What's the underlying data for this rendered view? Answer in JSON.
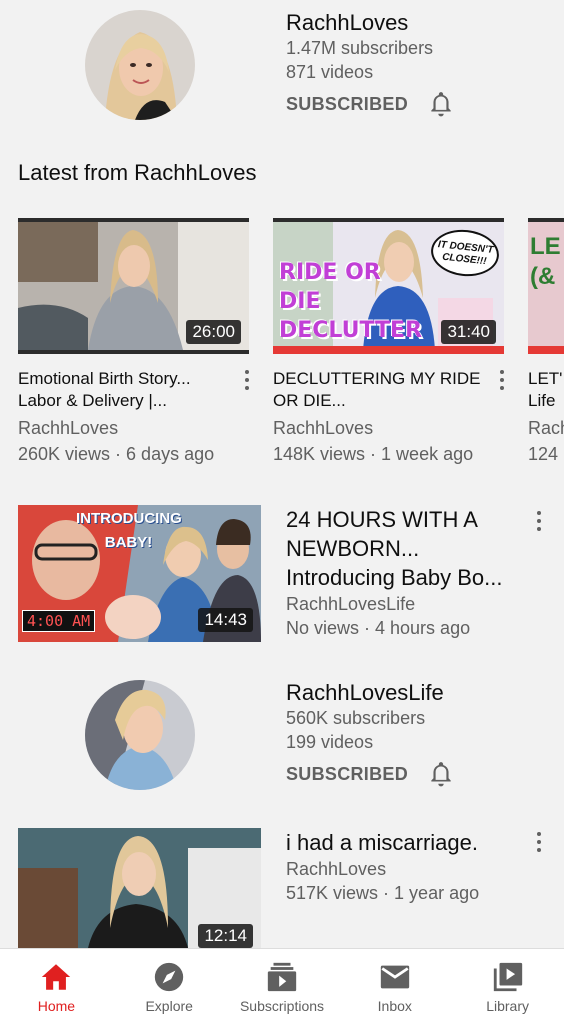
{
  "channel_1": {
    "name": "RachhLoves",
    "subscribers": "1.47M subscribers",
    "videos": "871 videos",
    "status": "SUBSCRIBED"
  },
  "section": {
    "title": "Latest from RachhLoves"
  },
  "shelf": [
    {
      "title": "Emotional Birth Story... Labor & Delivery |...",
      "channel": "RachhLoves",
      "meta": "260K views · 6 days ago",
      "duration": "26:00"
    },
    {
      "title": "DECLUTTERING MY RIDE OR DIE...",
      "channel": "RachhLoves",
      "meta": "148K views · 1 week ago",
      "duration": "31:40",
      "overlay_text": "RIDE OR DIE DECLUTTER",
      "bubble_text": "IT DOESN'T CLOSE!!!"
    },
    {
      "title": "LET' Life",
      "channel": "Rach",
      "meta": "124",
      "overlay_text": "LE (&"
    }
  ],
  "video_1": {
    "title": "24 HOURS WITH A NEWBORN... Introducing Baby Bo...",
    "channel": "RachhLovesLife",
    "meta": "No views · 4 hours ago",
    "duration": "14:43",
    "overlay_text": "INTRODUCING BABY!",
    "clock_text": "4:00 AM"
  },
  "channel_2": {
    "name": "RachhLovesLife",
    "subscribers": "560K subscribers",
    "videos": "199 videos",
    "status": "SUBSCRIBED"
  },
  "video_2": {
    "title": "i had a miscarriage.",
    "channel": "RachhLoves",
    "meta": "517K views · 1 year ago",
    "duration": "12:14"
  },
  "nav": [
    {
      "label": "Home",
      "icon": "home-icon"
    },
    {
      "label": "Explore",
      "icon": "compass-icon"
    },
    {
      "label": "Subscriptions",
      "icon": "subscriptions-icon"
    },
    {
      "label": "Inbox",
      "icon": "mail-icon"
    },
    {
      "label": "Library",
      "icon": "library-icon"
    }
  ],
  "colors": {
    "accent": "#e02020",
    "background": "#f2f2f2",
    "secondary_text": "#606060"
  }
}
